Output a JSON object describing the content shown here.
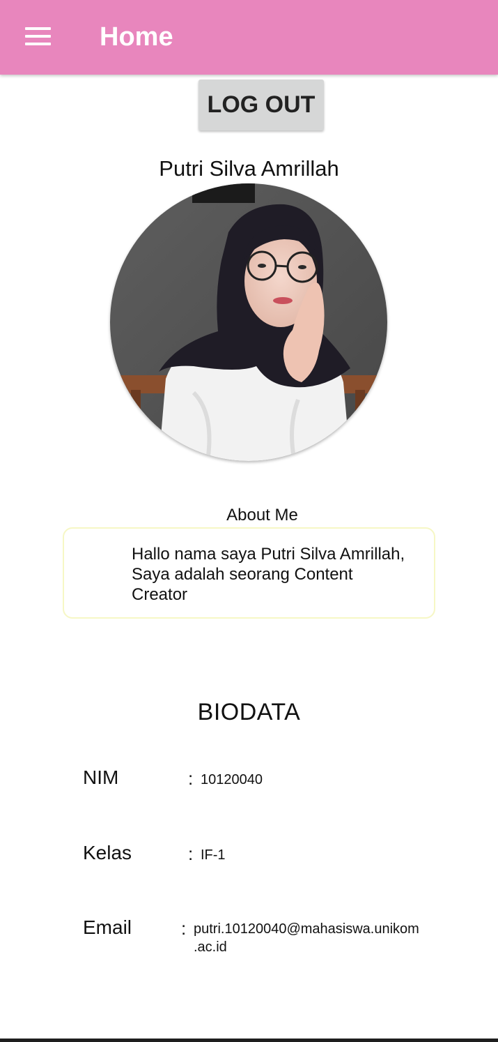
{
  "appbar": {
    "title": "Home",
    "menu_icon": "hamburger-menu-icon",
    "color": "#e886bd"
  },
  "logout": {
    "label": "LOG OUT"
  },
  "profile": {
    "name": "Putri Silva Amrillah"
  },
  "about": {
    "title": "About Me",
    "text": "Hallo nama saya Putri Silva Amrillah, Saya adalah seorang Content Creator"
  },
  "biodata": {
    "title": "BIODATA",
    "nim": {
      "label": "NIM",
      "separator": ":",
      "value": "10120040"
    },
    "kelas": {
      "label": "Kelas",
      "separator": ":",
      "value": "IF-1"
    },
    "email": {
      "label": "Email",
      "separator": ":",
      "value_line1": "putri.10120040@mahasiswa.unikom",
      "value_line2": ".ac.id"
    }
  }
}
